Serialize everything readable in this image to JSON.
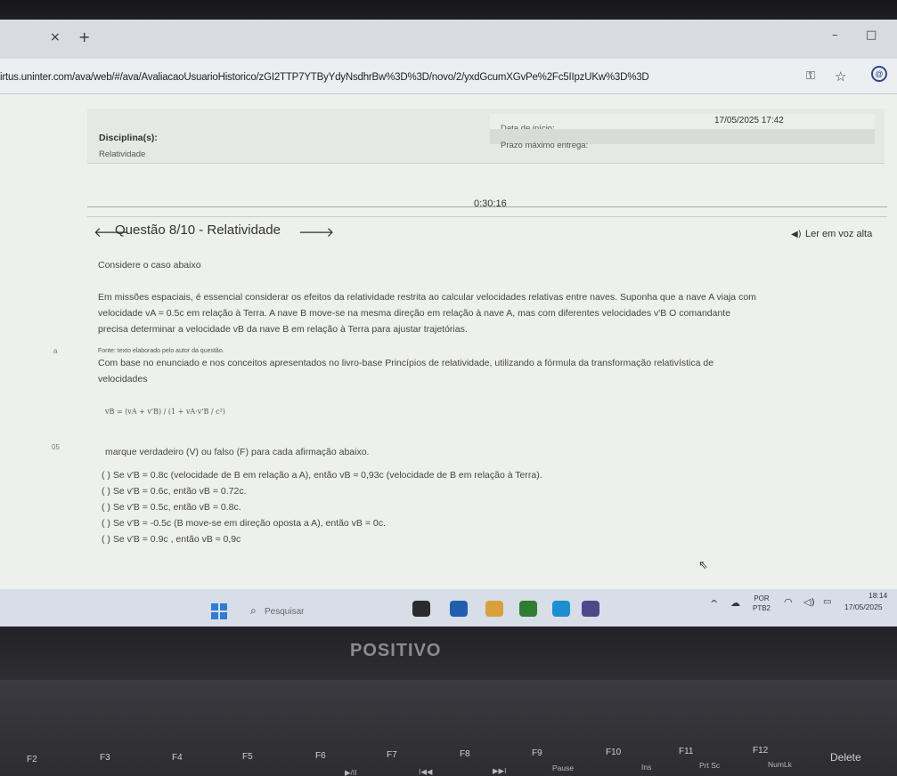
{
  "browser": {
    "tab_close": "×",
    "tab_new": "+",
    "min": "–",
    "max": "□",
    "url": "irtus.uninter.com/ava/web/#/ava/AvaliacaoUsuarioHistorico/zGI2TTP7YTByYdyNsdhrBw%3D%3D/novo/2/yxdGcumXGvPe%2Fc5IIpzUKw%3D%3D",
    "key_icon": "⚿",
    "star_icon": "☆",
    "profile_icon": "@"
  },
  "info": {
    "discipline_label": "Disciplina(s):",
    "discipline_value": "Relatividade",
    "start_label": "Data de início:",
    "start_value": "17/05/2025 17:42",
    "deadline_label": "Prazo máximo entrega:"
  },
  "timer": "0:30:16",
  "question": {
    "prev_icon": "🡐",
    "title": "Questão 8/10 - Relatividade",
    "next_icon": "🡒",
    "tts_icon": "◀)",
    "tts_label": "Ler em voz alta",
    "case": "Considere o caso abaixo",
    "p1": "Em missões espaciais, é essencial considerar os efeitos da relatividade restrita ao calcular velocidades relativas entre naves. Suponha que a nave A viaja com",
    "p2": "velocidade  vA = 0.5c  em relação à Terra. A nave B move-se na mesma direção em relação à nave A, mas com diferentes velocidades  v'B  O comandante",
    "p3": "precisa determinar a velocidade vB  da nave B em relação à Terra para ajustar trajetórias.",
    "source": "Fonte: texto elaborado pelo autor da questão.",
    "p4": "Com base no enunciado e nos conceitos apresentados no livro-base Princípios de relatividade, utilizando a fórmula da transformação relativística de",
    "p5": "velocidades",
    "formula": "vB = (vA + v'B) / (1 + vA·v'B / c²)",
    "p6": "marque verdadeiro (V) ou falso (F) para cada afirmação abaixo.",
    "options": [
      "( ) Se  v'B = 0.8c  (velocidade de B em relação a A), então  vB ≈ 0,93c  (velocidade de B em relação à Terra).",
      "( ) Se  v'B = 0.6c, então  vB = 0.72c.",
      "( ) Se  v'B = 0.5c, então  vB = 0.8c.",
      "( ) Se  v'B = -0.5c  (B move-se em direção oposta a A), então  vB = 0c.",
      "( ) Se  v'B = 0.9c , então  vB ≈ 0,9c"
    ],
    "margin_a": "a",
    "margin_b": "05"
  },
  "cursor_icon": "⇖",
  "taskbar": {
    "search_icon": "⌕",
    "search_placeholder": "Pesquisar",
    "chevron": "^",
    "cloud_icon": "☁",
    "lang_1": "POR",
    "lang_2": "PTB2",
    "wifi_icon": "◠",
    "vol_icon": "◁)",
    "bat_icon": "▭",
    "time": "18:14",
    "date": "17/05/2025",
    "app_colors": [
      "#2b2b2b",
      "#1f5fae",
      "#d9a03a",
      "#2e7d32",
      "#1b8fd1",
      "#4a4a8a"
    ]
  },
  "laptop": {
    "brand": "POSITIVO",
    "keys": [
      "F2",
      "F3",
      "F4",
      "F5",
      "F6",
      "F7",
      "F8",
      "F9",
      "F10",
      "F11",
      "F12",
      "Delete"
    ],
    "subs": [
      "▶/II",
      "I◀◀",
      "▶▶I",
      "Pause",
      "Ins",
      "Prt Sc",
      "NumLk"
    ]
  }
}
